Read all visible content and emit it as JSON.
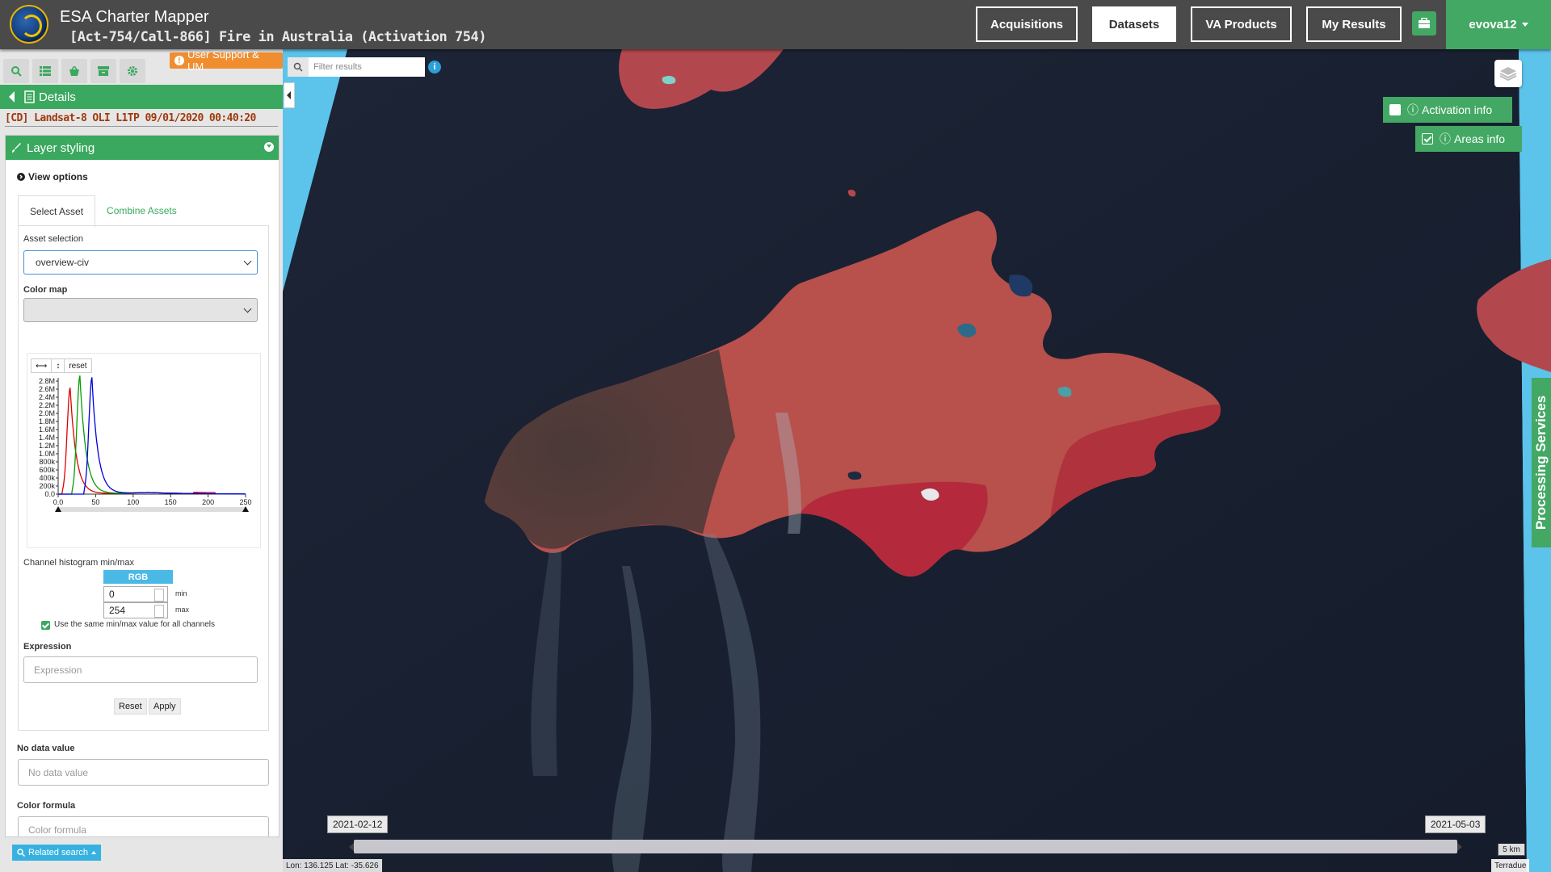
{
  "header": {
    "app_title": "ESA Charter Mapper",
    "subtitle": "[Act-754/Call-866] Fire in Australia (Activation 754)",
    "nav": [
      "Acquisitions",
      "Datasets",
      "VA Products",
      "My Results"
    ],
    "active_nav": "Datasets",
    "user": "evova12"
  },
  "sidebar": {
    "toolbar_icons": [
      "search-icon",
      "list-icon",
      "basket-icon",
      "archive-icon",
      "gear-icon"
    ],
    "support_label": "User Support & UM",
    "details_label": "Details",
    "dataset_title": "[CD] Landsat-8 OLI L1TP 09/01/2020 00:40:20",
    "panel_title": "Layer styling",
    "view_options": "View options",
    "tabs": [
      "Select Asset",
      "Combine Assets"
    ],
    "asset_selection_label": "Asset selection",
    "asset_value": "overview-civ",
    "color_map_label": "Color map",
    "color_map_value": "",
    "hist_reset": "reset",
    "hist_y_ticks": [
      "2.8M",
      "2.6M",
      "2.4M",
      "2.2M",
      "2.0M",
      "1.8M",
      "1.6M",
      "1.4M",
      "1.2M",
      "1.0M",
      "800k",
      "600k",
      "400k",
      "200k",
      "0.0"
    ],
    "hist_x_ticks": [
      "0.0",
      "50",
      "100",
      "150",
      "200",
      "250"
    ],
    "channel_label": "Channel histogram min/max",
    "rgb_label": "RGB",
    "min_value": "0",
    "max_value": "254",
    "min_label": "min",
    "max_label": "max",
    "same_minmax_label": "Use the same min/max value for all channels",
    "expression_label": "Expression",
    "expression_placeholder": "Expression",
    "reset_btn": "Reset",
    "apply_btn": "Apply",
    "nodata_label": "No data value",
    "nodata_placeholder": "No data value",
    "color_formula_label": "Color formula",
    "color_formula_placeholder": "Color formula",
    "related_search": "Related search"
  },
  "map": {
    "filter_placeholder": "Filter results",
    "activation_info": "Activation info",
    "areas_info": "Areas info",
    "processing_services": "Processing Services",
    "time_start": "2021-02-12",
    "time_end": "2021-05-03",
    "scale": "5 km",
    "coords": "Lon: 136.125 Lat: -35.626",
    "attribution": "Terradue"
  },
  "chart_data": {
    "type": "line",
    "x_ticks": [
      0,
      50,
      100,
      150,
      200,
      250
    ],
    "ylim": [
      0,
      2900000
    ],
    "series": [
      {
        "color": "#e00000",
        "peak_x": 16,
        "peak_y": 2650000
      },
      {
        "color": "#00a000",
        "peak_x": 29,
        "peak_y": 2950000
      },
      {
        "color": "#0000e0",
        "peak_x": 45,
        "peak_y": 2900000
      }
    ]
  }
}
